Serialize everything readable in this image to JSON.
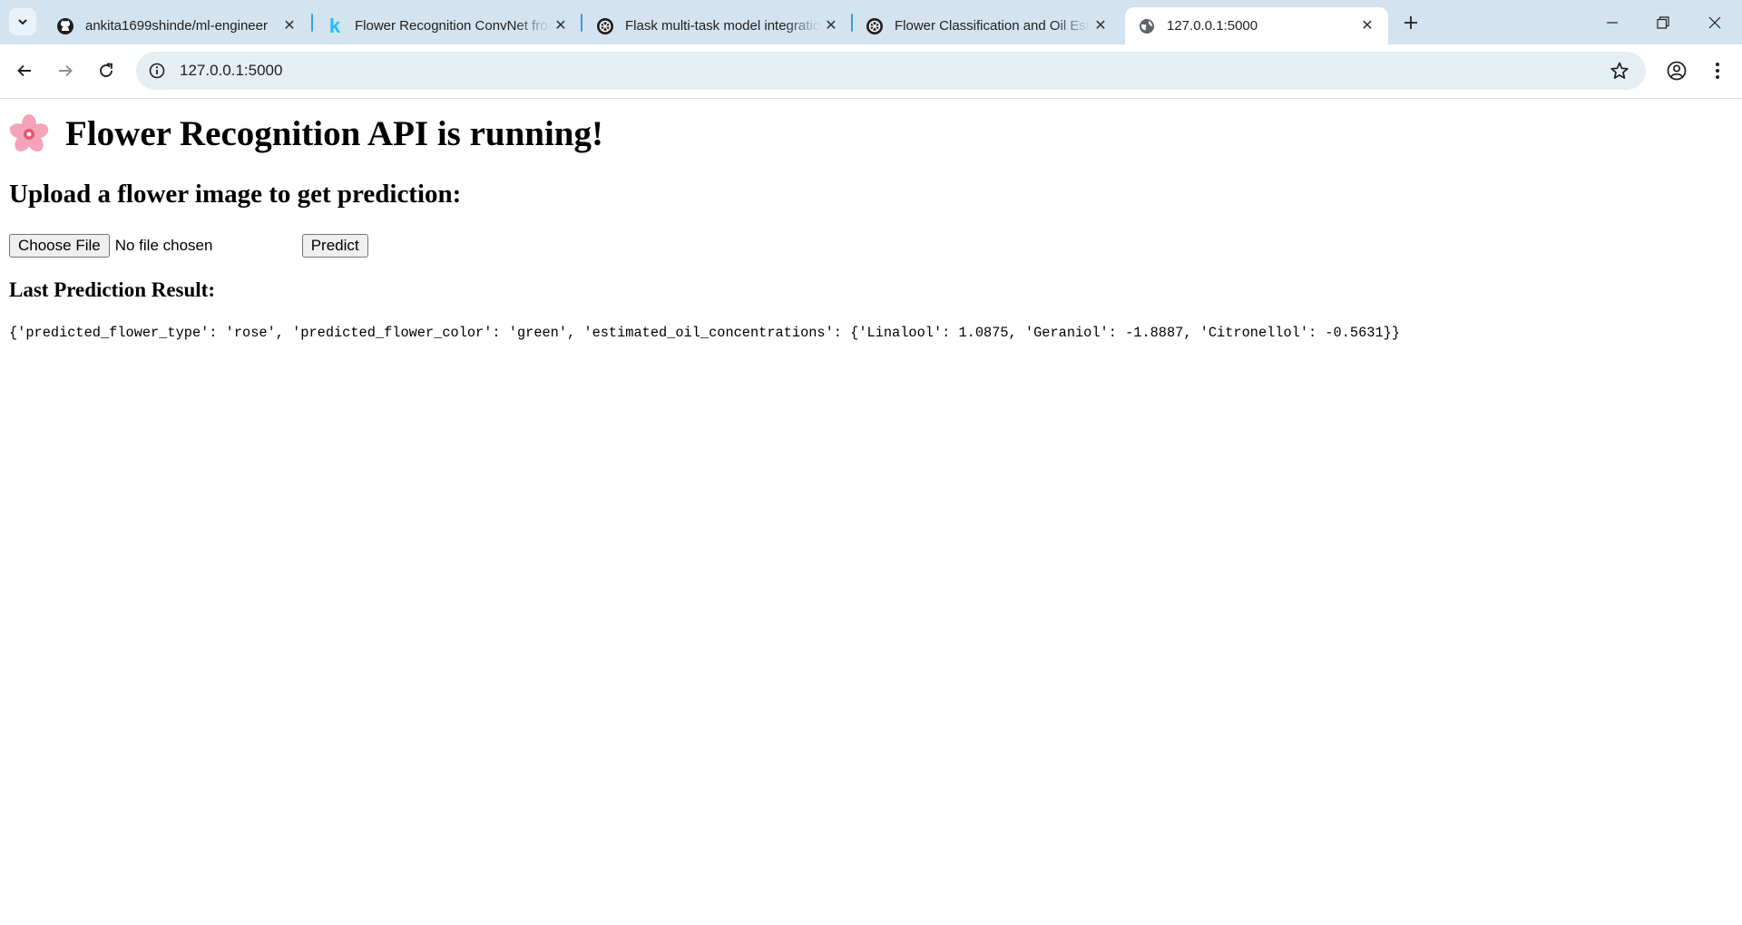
{
  "browser": {
    "tabs": [
      {
        "title": "ankita1699shinde/ml-engineer",
        "icon": "github-icon",
        "active": false
      },
      {
        "title": "Flower Recognition ConvNet from",
        "icon": "kaggle-icon",
        "active": false
      },
      {
        "title": "Flask multi-task model integration",
        "icon": "chatgpt-icon",
        "active": false
      },
      {
        "title": "Flower Classification and Oil Est",
        "icon": "chatgpt-icon",
        "active": false
      },
      {
        "title": "127.0.0.1:5000",
        "icon": "globe-icon",
        "active": true
      }
    ],
    "address_bar": {
      "url": "127.0.0.1:5000"
    },
    "accent_color": "#d3e3ef"
  },
  "page": {
    "heading": "Flower Recognition API is running!",
    "heading_emoji": "cherry-blossom-icon",
    "subheading": "Upload a flower image to get prediction:",
    "file_input": {
      "button_label": "Choose File",
      "status": "No file chosen"
    },
    "predict_label": "Predict",
    "result_heading": "Last Prediction Result:",
    "result_text": "{'predicted_flower_type': 'rose', 'predicted_flower_color': 'green', 'estimated_oil_concentrations': {'Linalool': 1.0875, 'Geraniol': -1.8887, 'Citronellol': -0.5631}}"
  }
}
